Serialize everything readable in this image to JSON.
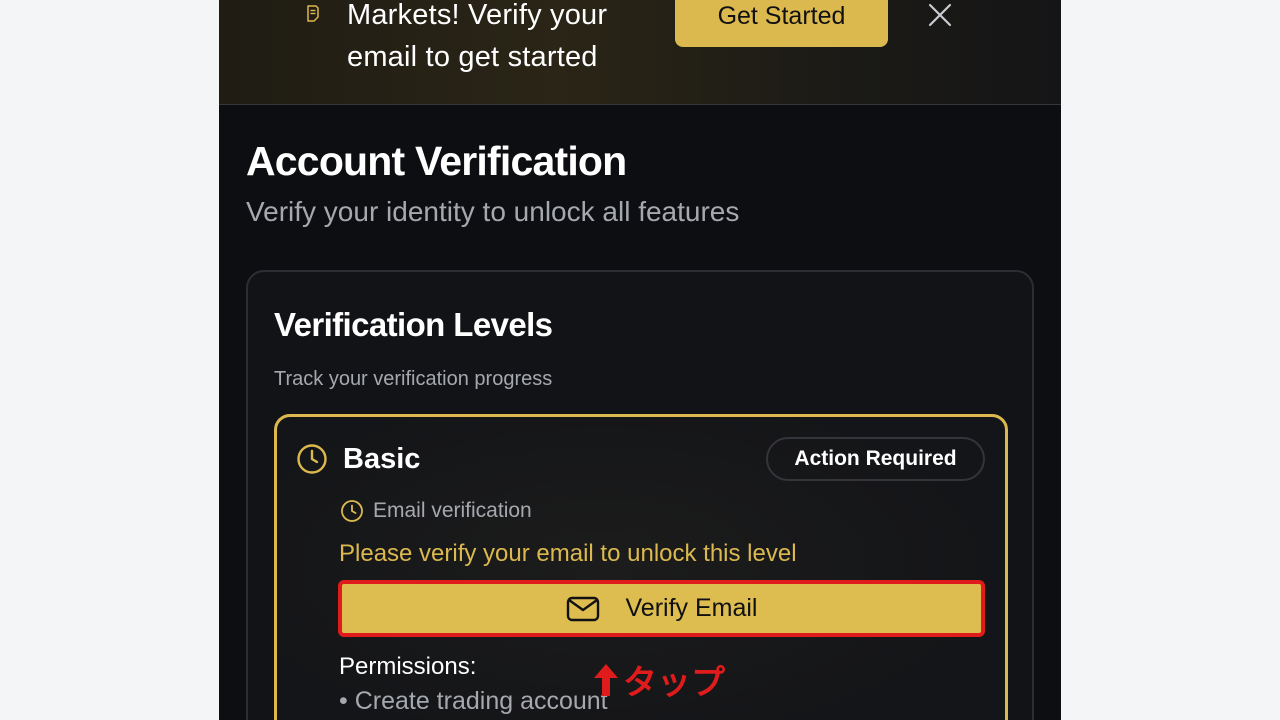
{
  "banner": {
    "text": "Markets! Verify your email to get started",
    "button_label": "Get Started",
    "icon": "document-icon",
    "close_icon": "close-icon"
  },
  "page": {
    "title": "Account Verification",
    "subtitle": "Verify your identity to unlock all features"
  },
  "card": {
    "title": "Verification Levels",
    "description": "Track your verification progress",
    "level": {
      "name": "Basic",
      "badge": "Action Required",
      "requirement": "Email verification",
      "warning": "Please verify your email to unlock this level",
      "button_label": "Verify Email",
      "permissions_title": "Permissions:",
      "permissions": [
        "• Create trading account"
      ]
    }
  },
  "annotation": {
    "text": "タップ"
  },
  "colors": {
    "accent": "#dcb94e",
    "annotation_red": "#e01b1b",
    "background": "#0d0e11",
    "page_outer": "#f4f5f7"
  }
}
